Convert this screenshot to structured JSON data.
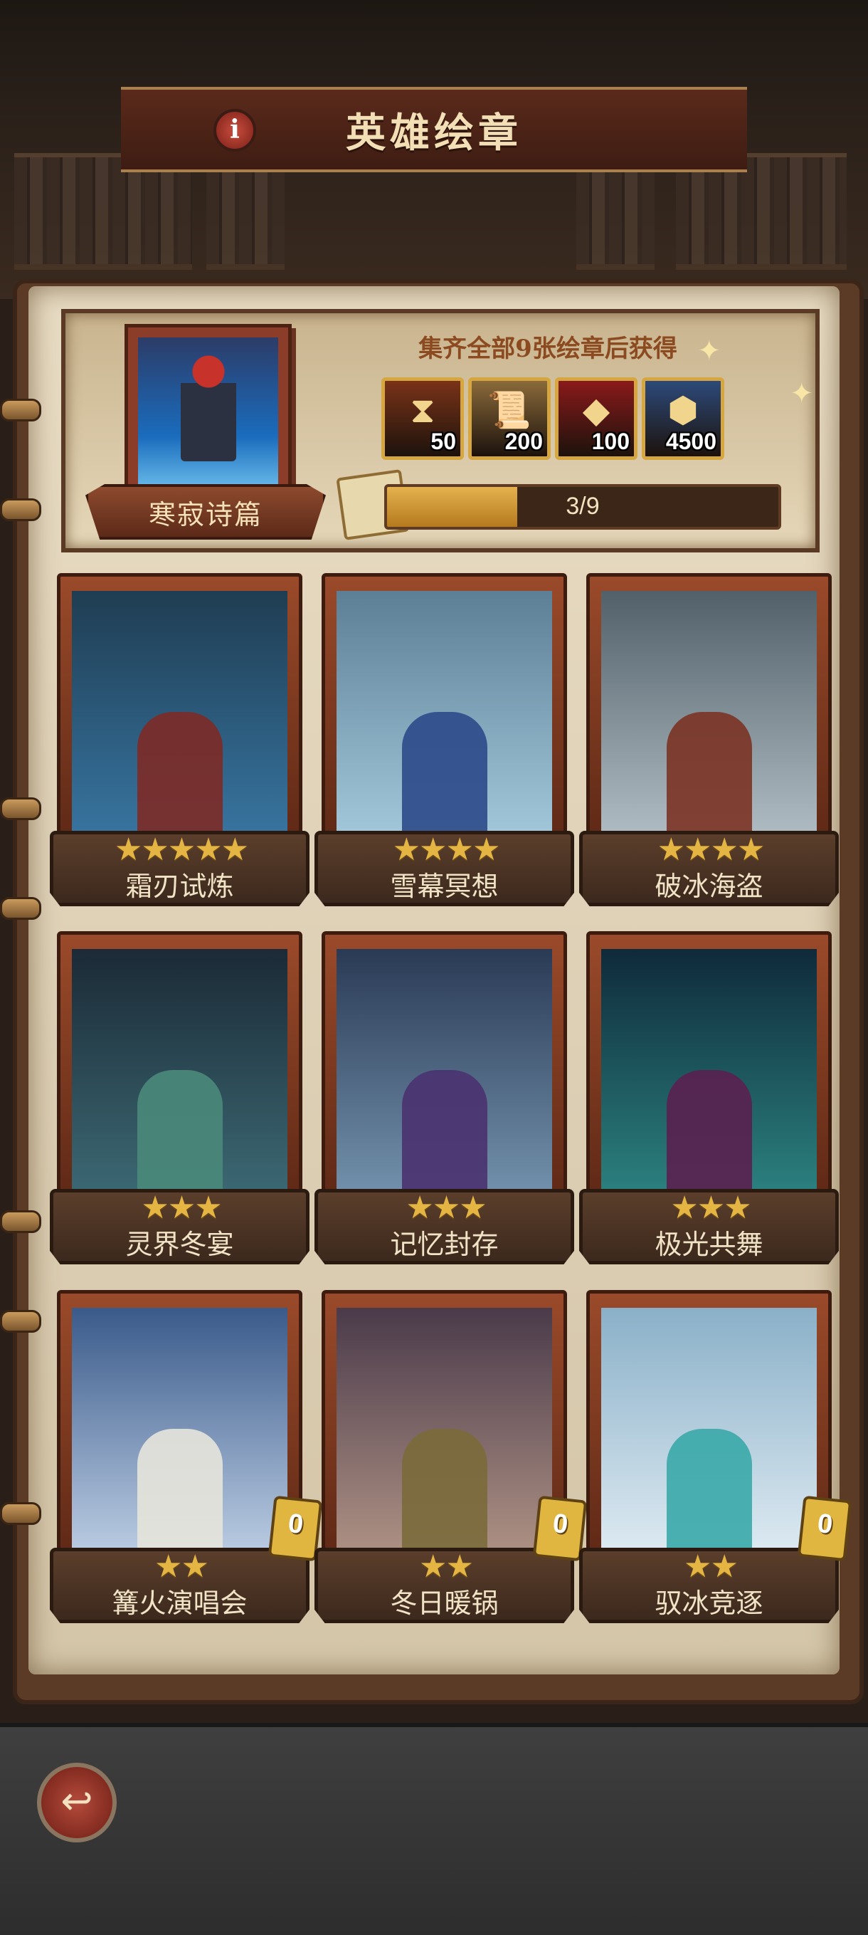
{
  "header": {
    "title": "英雄绘章"
  },
  "album": {
    "name": "寒寂诗篇",
    "reward_title": "集齐全部9张绘章后获得",
    "rewards": [
      {
        "icon": "hourglass-icon",
        "count": "50",
        "color": "#7a3318"
      },
      {
        "icon": "scroll-icon",
        "count": "200",
        "color": "#8a6a3a"
      },
      {
        "icon": "red-gem-icon",
        "count": "100",
        "color": "#8a1a1a"
      },
      {
        "icon": "ore-icon",
        "count": "4500",
        "color": "#2d4a7a"
      }
    ],
    "progress_text": "3/9",
    "progress_fraction": 0.333
  },
  "cards": [
    {
      "name": "霜刃试炼",
      "stars": 5,
      "palette": [
        "#1f3d52",
        "#3a7aa8"
      ],
      "figure": "#7d2a26"
    },
    {
      "name": "雪幕冥想",
      "stars": 4,
      "palette": [
        "#5d7f96",
        "#a9cfe1"
      ],
      "figure": "#2c4a8a"
    },
    {
      "name": "破冰海盗",
      "stars": 4,
      "palette": [
        "#52606a",
        "#b9c6cc"
      ],
      "figure": "#7b3325"
    },
    {
      "name": "灵界冬宴",
      "stars": 3,
      "palette": [
        "#1b2a36",
        "#3f6f7a"
      ],
      "figure": "#4a8a7a"
    },
    {
      "name": "记忆封存",
      "stars": 3,
      "palette": [
        "#2a3a55",
        "#7a9ab5"
      ],
      "figure": "#4a3270"
    },
    {
      "name": "极光共舞",
      "stars": 3,
      "palette": [
        "#0f2a3a",
        "#2e8a86"
      ],
      "figure": "#5a2050"
    },
    {
      "name": "篝火演唱会",
      "stars": 2,
      "palette": [
        "#3a5a8a",
        "#c8d8ec"
      ],
      "figure": "#e7e4dc",
      "count": "0"
    },
    {
      "name": "冬日暖锅",
      "stars": 2,
      "palette": [
        "#4a3a4a",
        "#b89a8a"
      ],
      "figure": "#7a6a3a",
      "count": "0"
    },
    {
      "name": "驭冰竞逐",
      "stars": 2,
      "palette": [
        "#8ab0c8",
        "#e6f0f6"
      ],
      "figure": "#3aa8a8",
      "count": "0"
    }
  ]
}
